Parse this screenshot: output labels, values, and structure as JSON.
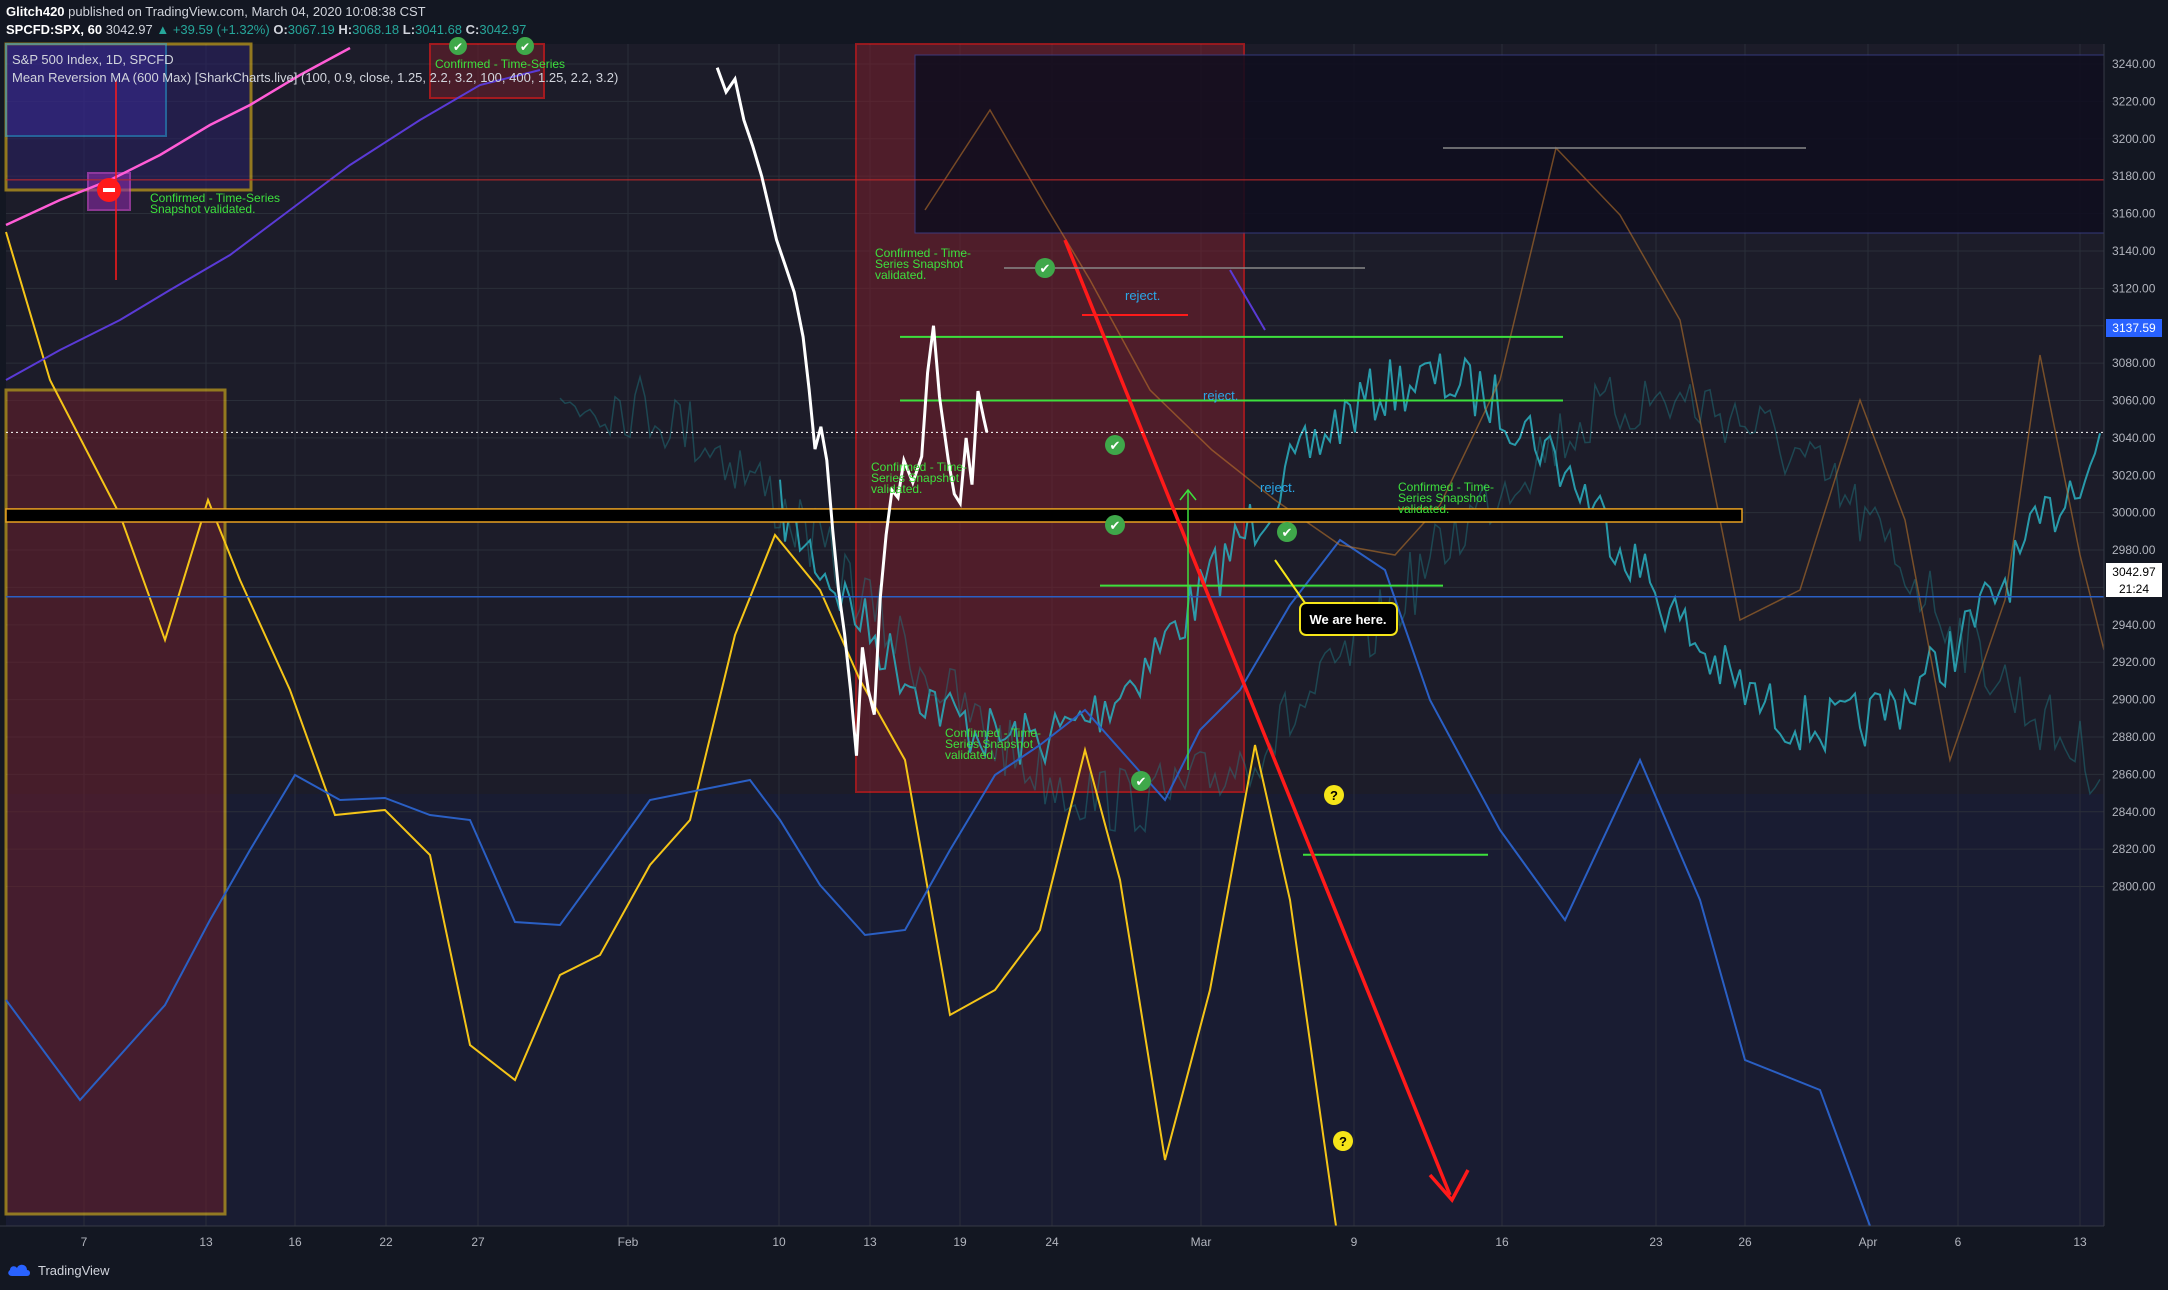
{
  "header": {
    "author": "Glitch420",
    "published_text": " published on TradingView.com, March 04, 2020 10:08:38 CST",
    "symbol": "SPCFD:SPX, 60",
    "last": "3042.97",
    "change": "+39.59 (+1.32%)",
    "open_label": "O:",
    "open": "3067.19",
    "high_label": "H:",
    "high": "3068.18",
    "low_label": "L:",
    "low": "3041.68",
    "close_label": "C:",
    "close": "3042.97"
  },
  "legend": {
    "series_title": "S&P 500 Index, 1D, SPCFD",
    "indicator": "Mean Reversion MA (600 Max) [SharkCharts.live] (100, 0.9, close, 1.25, 2.2, 3.2, 100, 400, 1.25, 2.2, 3.2)"
  },
  "footer": {
    "brand": "TradingView"
  },
  "colors": {
    "background": "#131722",
    "price_line": "#ffffff",
    "overlay_teal": "#2aa8b8",
    "yellow": "#f5c518",
    "red": "#ff1a1a",
    "green": "#3de03d",
    "blue": "#2a5fc4",
    "magenta": "#ff5cd6"
  },
  "annotations": {
    "confirmed": "Confirmed - Time-Series Snapshot validated.",
    "reject": "reject.",
    "we_are_here": "We are here.",
    "question": "?",
    "badge_time": "21:24"
  },
  "chart_data": {
    "type": "line",
    "title": "S&P 500 Index, 1D, SPCFD",
    "xlabel": "",
    "ylabel": "",
    "ylim": [
      2790,
      3250
    ],
    "y_ticks": [
      2800,
      2820,
      2840,
      2860,
      2880,
      2900,
      2920,
      2940,
      2960,
      2980,
      3000,
      3020,
      3040,
      3060,
      3080,
      3100,
      3120,
      3140,
      3160,
      3180,
      3200,
      3220,
      3240
    ],
    "y_tick_labels": [
      "2800.00",
      "2820.00",
      "2840.00",
      "2860.00",
      "2880.00",
      "2900.00",
      "2920.00",
      "2940.00",
      "2960.00",
      "2980.00",
      "3000.00",
      "3020.00",
      "3040.00",
      "3060.00",
      "3080.00",
      "3100.00",
      "3120.00",
      "3140.00",
      "3160.00",
      "3180.00",
      "3200.00",
      "3220.00",
      "3240.00"
    ],
    "x_ticks": [
      "7",
      "13",
      "16",
      "22",
      "27",
      "Feb",
      "10",
      "13",
      "19",
      "24",
      "Mar",
      "9",
      "16",
      "23",
      "26",
      "Apr",
      "6",
      "13"
    ],
    "last_price_marker": "3042.97",
    "mid_marker": "3137.59",
    "levels": {
      "black_band": [
        2995,
        3002
      ],
      "green_lines": [
        3094,
        3060,
        2961,
        2817
      ]
    },
    "series": [
      {
        "name": "SPX (hourly)",
        "points": [
          [
            24,
            3238
          ],
          [
            24.3,
            3225
          ],
          [
            24.6,
            3232
          ],
          [
            24.9,
            3210
          ],
          [
            25.2,
            3196
          ],
          [
            25.5,
            3180
          ],
          [
            25.8,
            3160
          ],
          [
            26,
            3146
          ],
          [
            26.3,
            3132
          ],
          [
            26.6,
            3118
          ],
          [
            26.9,
            3094
          ],
          [
            27.1,
            3066
          ],
          [
            27.3,
            3034
          ],
          [
            27.5,
            3046
          ],
          [
            27.7,
            3028
          ],
          [
            27.9,
            2990
          ],
          [
            28.1,
            2958
          ],
          [
            28.3,
            2935
          ],
          [
            28.5,
            2905
          ],
          [
            28.7,
            2870
          ],
          [
            28.9,
            2928
          ],
          [
            29.1,
            2905
          ],
          [
            29.3,
            2892
          ],
          [
            29.5,
            2954
          ],
          [
            29.7,
            2988
          ],
          [
            29.9,
            3012
          ],
          [
            30.1,
            3008
          ],
          [
            30.3,
            3028
          ],
          [
            30.6,
            3016
          ],
          [
            30.9,
            3030
          ],
          [
            31.1,
            3075
          ],
          [
            31.3,
            3100
          ],
          [
            31.5,
            3062
          ],
          [
            31.8,
            3028
          ],
          [
            32,
            3010
          ],
          [
            32.2,
            3005
          ],
          [
            32.4,
            3040
          ],
          [
            32.6,
            3015
          ],
          [
            32.8,
            3065
          ],
          [
            33,
            3050
          ],
          [
            33.1,
            3043
          ]
        ]
      }
    ]
  }
}
